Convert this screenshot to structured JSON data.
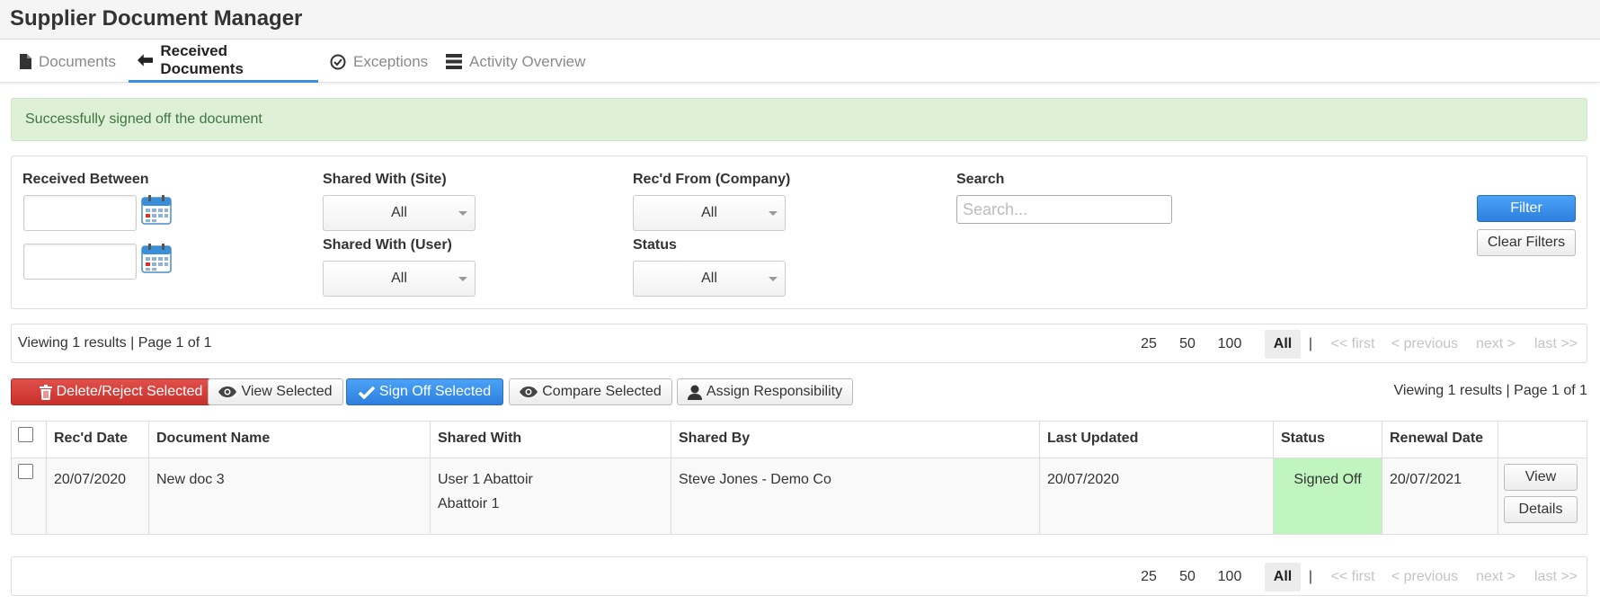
{
  "app": {
    "title": "Supplier Document Manager"
  },
  "tabs": [
    {
      "label": "Documents",
      "icon": "file-icon",
      "active": false
    },
    {
      "label": "Received Documents",
      "icon": "arrow-left-icon",
      "active": true
    },
    {
      "label": "Exceptions",
      "icon": "check-circle-icon",
      "active": false
    },
    {
      "label": "Activity Overview",
      "icon": "list-icon",
      "active": false
    }
  ],
  "alert": {
    "message": "Successfully signed off the document",
    "color": "#3c763d"
  },
  "filters": {
    "received_between_label": "Received Between",
    "date_from_value": "",
    "date_to_value": "",
    "shared_site_label": "Shared With (Site)",
    "shared_site_value": "All",
    "shared_user_label": "Shared With (User)",
    "shared_user_value": "All",
    "recd_from_label": "Rec'd From (Company)",
    "recd_from_value": "All",
    "status_label": "Status",
    "status_value": "All",
    "search_label": "Search",
    "search_placeholder": "Search...",
    "filter_button": "Filter",
    "clear_button": "Clear Filters"
  },
  "pager_top": {
    "info": "Viewing 1 results | Page 1 of 1",
    "sizes": [
      "25",
      "50",
      "100",
      "All"
    ],
    "selected": "All",
    "separator": "|",
    "first": "<< first",
    "previous": "< previous",
    "next": "next >",
    "last": "last >>"
  },
  "actions": {
    "delete": "Delete/Reject Selected",
    "view": "View Selected",
    "sign_off": "Sign Off Selected",
    "compare": "Compare Selected",
    "assign": "Assign Responsibility",
    "info": "Viewing 1 results | Page 1 of 1"
  },
  "table": {
    "columns": [
      "Rec'd Date",
      "Document Name",
      "Shared With",
      "Shared By",
      "Last Updated",
      "Status",
      "Renewal Date"
    ],
    "rows": [
      {
        "recd_date": "20/07/2020",
        "document_name": "New doc 3",
        "shared_with_1": "User 1 Abattoir",
        "shared_with_2": "Abattoir 1",
        "shared_by": "Steve Jones - Demo Co",
        "last_updated": "20/07/2020",
        "status": "Signed Off",
        "renewal_date": "20/07/2021",
        "view_button": "View",
        "details_button": "Details"
      }
    ],
    "status_color": "#c0f5c0"
  },
  "pager_bottom": {
    "sizes": [
      "25",
      "50",
      "100",
      "All"
    ],
    "selected": "All",
    "separator": "|",
    "first": "<< first",
    "previous": "< previous",
    "next": "next >",
    "last": "last >>"
  },
  "colors": {
    "primary": "#3a8ee6",
    "danger": "#c9302c",
    "success_bg": "#dff0d8"
  }
}
